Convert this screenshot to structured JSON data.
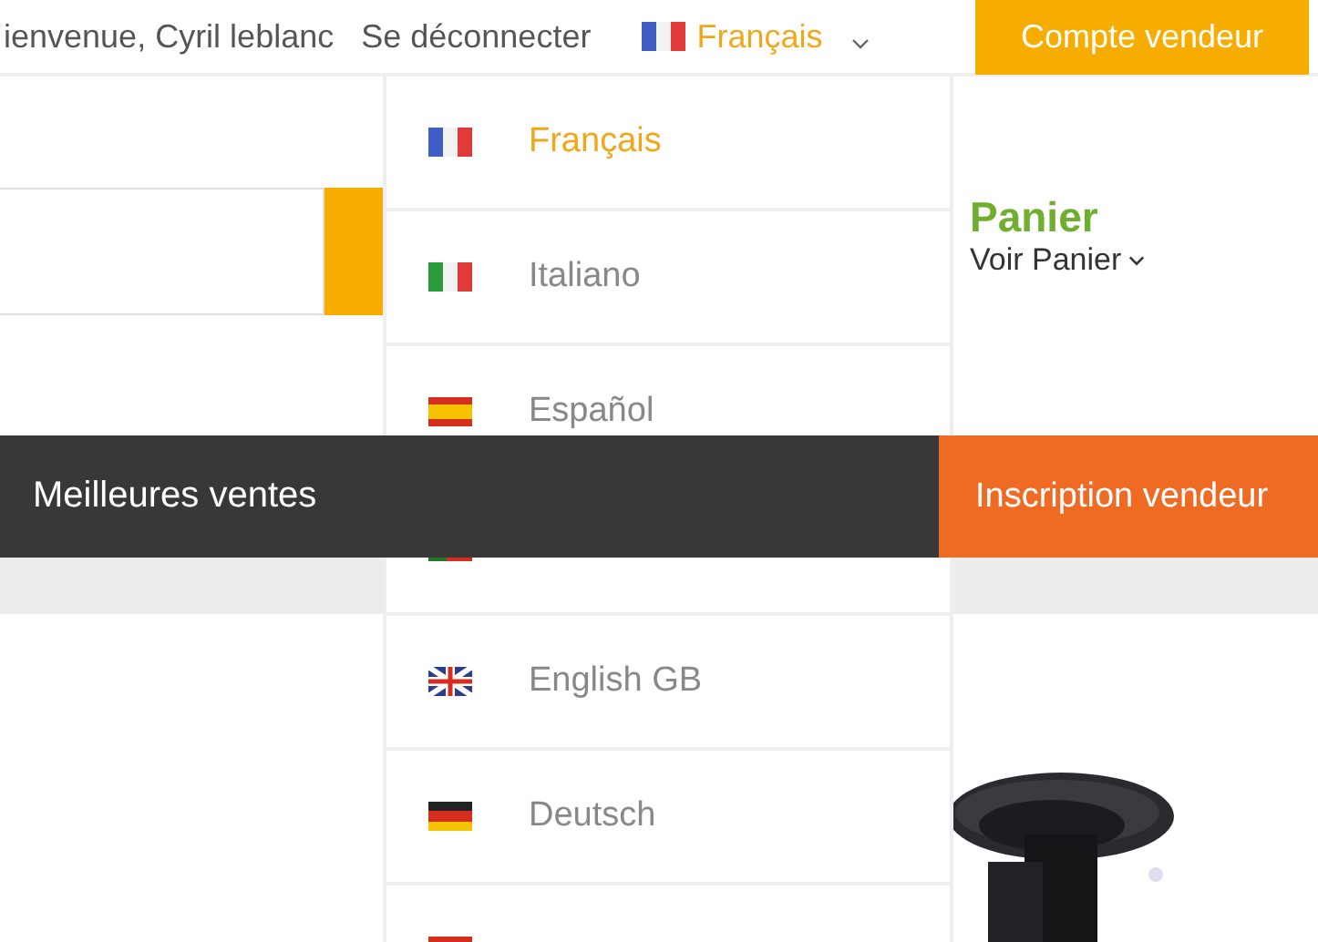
{
  "top_bar": {
    "welcome": "ienvenue, Cyril leblanc",
    "logout": "Se déconnecter",
    "language": {
      "kind": "fr",
      "label": "Français",
      "expanded": true
    },
    "seller_button": "Compte vendeur"
  },
  "header": {
    "cart_title": "Panier",
    "cart_link": "Voir Panier"
  },
  "language_menu": [
    {
      "kind": "fr",
      "label": "Français",
      "selected": true
    },
    {
      "kind": "it",
      "label": "Italiano",
      "selected": false
    },
    {
      "kind": "es",
      "label": "Español",
      "selected": false
    },
    {
      "kind": "pt"
    },
    {
      "kind": "gb",
      "label": "English GB",
      "selected": false
    },
    {
      "kind": "de",
      "label": "Deutsch",
      "selected": false
    },
    {
      "kind": "nl"
    }
  ],
  "nav_bar": {
    "best_sellers": "Meilleures ventes",
    "seller_signup": "Inscription vendeur"
  }
}
